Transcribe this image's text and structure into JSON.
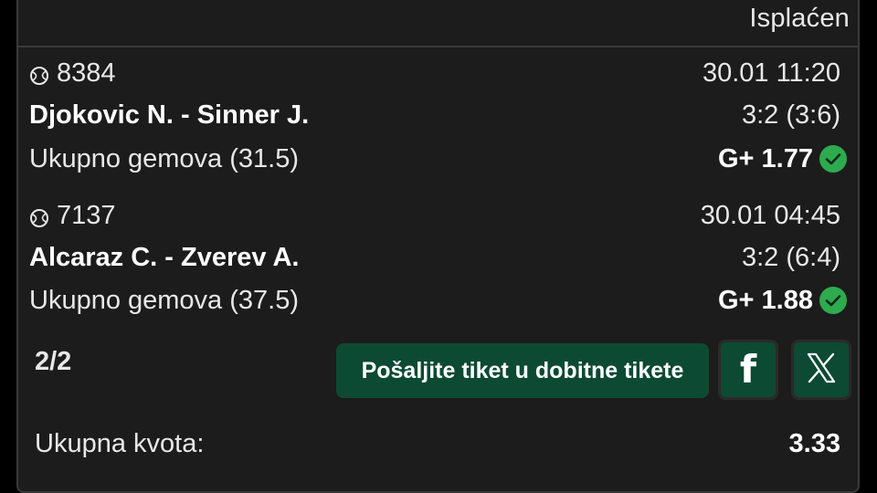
{
  "ticket": {
    "status": "Isplaćen",
    "count": "2/2",
    "send_button_label": "Pošaljite tiket u dobitne tikete",
    "total_label": "Ukupna kvota:",
    "total_value": "3.33"
  },
  "matches": [
    {
      "id": "8384",
      "datetime": "30.01 11:20",
      "teams": "Djokovic N. - Sinner J.",
      "score": "3:2 (3:6)",
      "market": "Ukupno gemova (31.5)",
      "odd": "G+ 1.77",
      "sport_icon": "tennis-ball-icon",
      "result_icon": "check-icon"
    },
    {
      "id": "7137",
      "datetime": "30.01 04:45",
      "teams": "Alcaraz C. - Zverev A.",
      "score": "3:2 (6:4)",
      "market": "Ukupno gemova (37.5)",
      "odd": "G+ 1.88",
      "sport_icon": "tennis-ball-icon",
      "result_icon": "check-icon"
    }
  ],
  "share": {
    "facebook_icon": "facebook-icon",
    "x_icon": "x-icon"
  },
  "colors": {
    "background": "#000000",
    "card": "#1c1c1c",
    "accent_green": "#0c4a34",
    "check_green": "#2eaa4f"
  }
}
